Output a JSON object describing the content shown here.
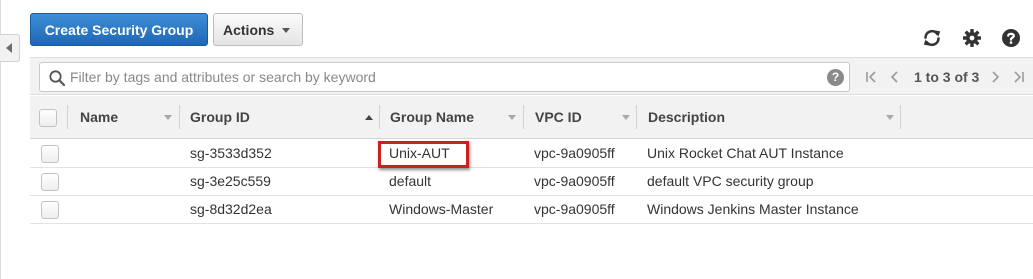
{
  "toolbar": {
    "create_label": "Create Security Group",
    "actions_label": "Actions",
    "icons": [
      "refresh-icon",
      "gear-icon",
      "help-icon"
    ]
  },
  "filter": {
    "placeholder": "Filter by tags and attributes or search by keyword",
    "value": "",
    "help_glyph": "?"
  },
  "pager": {
    "label": "1 to 3 of 3"
  },
  "columns": [
    "Name",
    "Group ID",
    "Group Name",
    "VPC ID",
    "Description"
  ],
  "sort": {
    "column": "Group ID",
    "direction": "ascending"
  },
  "rows": [
    {
      "name": "",
      "group_id": "sg-3533d352",
      "group_name": "Unix-AUT",
      "vpc_id": "vpc-9a0905ff",
      "description": "Unix Rocket Chat AUT Instance"
    },
    {
      "name": "",
      "group_id": "sg-3e25c559",
      "group_name": "default",
      "vpc_id": "vpc-9a0905ff",
      "description": "default VPC security group"
    },
    {
      "name": "",
      "group_id": "sg-8d32d2ea",
      "group_name": "Windows-Master",
      "vpc_id": "vpc-9a0905ff",
      "description": "Windows Jenkins Master Instance"
    }
  ],
  "colors": {
    "primary_button": "#2a7bc8",
    "annotation": "#cc1f1f",
    "header_bg": "#f2f2f2"
  }
}
